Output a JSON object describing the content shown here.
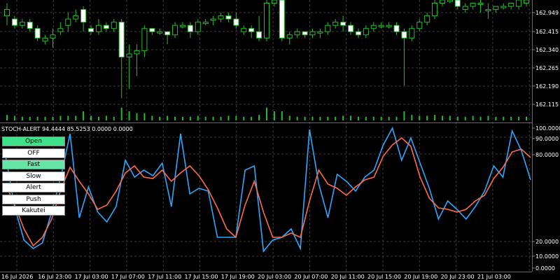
{
  "indicator_title": "STOCH-ALERT 94.4444 85.5253 0.0000 0.0000",
  "buttons": [
    {
      "label": "Open",
      "state": "on"
    },
    {
      "label": "OFF",
      "state": "off"
    },
    {
      "label": "Fast",
      "state": "on2"
    },
    {
      "label": "Slow",
      "state": "off"
    },
    {
      "label": "Alert",
      "state": "off"
    },
    {
      "label": "Push",
      "state": "off"
    },
    {
      "label": "Kakutei",
      "state": "off"
    }
  ],
  "colors": {
    "bull": "#ffffff",
    "bear": "#ffffff",
    "wick": "#1fbf2a",
    "volume": "#1fbf2a",
    "fast": "#2aa9ff",
    "slow": "#ff6a4d",
    "grid": "#3c3c3c"
  },
  "price_axis": [
    "162.949",
    "162.415",
    "162.340",
    "162.265",
    "162.190",
    "162.115"
  ],
  "stoch_axis": [
    "100.0000",
    "90.0000",
    "80.0000",
    "20.0000",
    "10.0000",
    "0.0000"
  ],
  "time_axis": [
    "16 Jul 2026",
    "16 Jul 23:00",
    "17 Jul 03:00",
    "17 Jul 07:00",
    "17 Jul 11:00",
    "17 Jul 15:00",
    "17 Jul 19:00",
    "20 Jul 03:00",
    "20 Jul 07:00",
    "20 Jul 11:00",
    "20 Jul 15:00",
    "20 Jul 19:00",
    "20 Jul 23:00",
    "21 Jul 03:00"
  ],
  "chart_data": {
    "type": "line",
    "title": "STOCH-ALERT",
    "price_ylim": [
      162.09,
      162.47
    ],
    "candles": [
      {
        "o": 162.42,
        "c": 162.44,
        "h": 162.46,
        "l": 162.39
      },
      {
        "o": 162.41,
        "c": 162.39,
        "h": 162.42,
        "l": 162.38
      },
      {
        "o": 162.39,
        "c": 162.4,
        "h": 162.41,
        "l": 162.38
      },
      {
        "o": 162.4,
        "c": 162.38,
        "h": 162.41,
        "l": 162.37
      },
      {
        "o": 162.38,
        "c": 162.35,
        "h": 162.39,
        "l": 162.34
      },
      {
        "o": 162.34,
        "c": 162.35,
        "h": 162.36,
        "l": 162.33
      },
      {
        "o": 162.35,
        "c": 162.36,
        "h": 162.38,
        "l": 162.32
      },
      {
        "o": 162.37,
        "c": 162.38,
        "h": 162.4,
        "l": 162.36
      },
      {
        "o": 162.39,
        "c": 162.41,
        "h": 162.43,
        "l": 162.37
      },
      {
        "o": 162.41,
        "c": 162.42,
        "h": 162.44,
        "l": 162.4
      },
      {
        "o": 162.44,
        "c": 162.4,
        "h": 162.45,
        "l": 162.37
      },
      {
        "o": 162.38,
        "c": 162.37,
        "h": 162.39,
        "l": 162.36
      },
      {
        "o": 162.37,
        "c": 162.39,
        "h": 162.41,
        "l": 162.36
      },
      {
        "o": 162.39,
        "c": 162.38,
        "h": 162.4,
        "l": 162.37
      },
      {
        "o": 162.38,
        "c": 162.4,
        "h": 162.41,
        "l": 162.37
      },
      {
        "o": 162.4,
        "c": 162.29,
        "h": 162.41,
        "l": 162.16
      },
      {
        "o": 162.29,
        "c": 162.3,
        "h": 162.33,
        "l": 162.19
      },
      {
        "o": 162.3,
        "c": 162.31,
        "h": 162.33,
        "l": 162.23
      },
      {
        "o": 162.31,
        "c": 162.38,
        "h": 162.39,
        "l": 162.29
      },
      {
        "o": 162.38,
        "c": 162.37,
        "h": 162.38,
        "l": 162.36
      },
      {
        "o": 162.37,
        "c": 162.37,
        "h": 162.38,
        "l": 162.36
      },
      {
        "o": 162.37,
        "c": 162.36,
        "h": 162.37,
        "l": 162.33
      },
      {
        "o": 162.36,
        "c": 162.39,
        "h": 162.4,
        "l": 162.35
      },
      {
        "o": 162.39,
        "c": 162.39,
        "h": 162.4,
        "l": 162.38
      },
      {
        "o": 162.39,
        "c": 162.37,
        "h": 162.4,
        "l": 162.35
      },
      {
        "o": 162.37,
        "c": 162.4,
        "h": 162.41,
        "l": 162.36
      },
      {
        "o": 162.4,
        "c": 162.4,
        "h": 162.41,
        "l": 162.39
      },
      {
        "o": 162.41,
        "c": 162.41,
        "h": 162.42,
        "l": 162.39
      },
      {
        "o": 162.41,
        "c": 162.42,
        "h": 162.43,
        "l": 162.4
      },
      {
        "o": 162.42,
        "c": 162.41,
        "h": 162.43,
        "l": 162.4
      },
      {
        "o": 162.41,
        "c": 162.39,
        "h": 162.43,
        "l": 162.38
      },
      {
        "o": 162.37,
        "c": 162.38,
        "h": 162.39,
        "l": 162.36
      },
      {
        "o": 162.38,
        "c": 162.37,
        "h": 162.39,
        "l": 162.35
      },
      {
        "o": 162.37,
        "c": 162.35,
        "h": 162.42,
        "l": 162.34
      },
      {
        "o": 162.35,
        "c": 162.46,
        "h": 162.48,
        "l": 162.34
      },
      {
        "o": 162.46,
        "c": 162.47,
        "h": 162.48,
        "l": 162.45
      },
      {
        "o": 162.47,
        "c": 162.35,
        "h": 162.48,
        "l": 162.34
      },
      {
        "o": 162.35,
        "c": 162.36,
        "h": 162.37,
        "l": 162.33
      },
      {
        "o": 162.36,
        "c": 162.37,
        "h": 162.38,
        "l": 162.35
      },
      {
        "o": 162.37,
        "c": 162.36,
        "h": 162.37,
        "l": 162.35
      },
      {
        "o": 162.36,
        "c": 162.37,
        "h": 162.38,
        "l": 162.35
      },
      {
        "o": 162.37,
        "c": 162.37,
        "h": 162.38,
        "l": 162.35
      },
      {
        "o": 162.37,
        "c": 162.39,
        "h": 162.4,
        "l": 162.36
      },
      {
        "o": 162.39,
        "c": 162.4,
        "h": 162.41,
        "l": 162.38
      },
      {
        "o": 162.4,
        "c": 162.39,
        "h": 162.42,
        "l": 162.37
      },
      {
        "o": 162.39,
        "c": 162.37,
        "h": 162.4,
        "l": 162.36
      },
      {
        "o": 162.37,
        "c": 162.36,
        "h": 162.38,
        "l": 162.35
      },
      {
        "o": 162.36,
        "c": 162.38,
        "h": 162.39,
        "l": 162.35
      },
      {
        "o": 162.38,
        "c": 162.39,
        "h": 162.4,
        "l": 162.37
      },
      {
        "o": 162.39,
        "c": 162.39,
        "h": 162.4,
        "l": 162.38
      },
      {
        "o": 162.39,
        "c": 162.39,
        "h": 162.4,
        "l": 162.38
      },
      {
        "o": 162.39,
        "c": 162.37,
        "h": 162.4,
        "l": 162.36
      },
      {
        "o": 162.37,
        "c": 162.35,
        "h": 162.38,
        "l": 162.2
      },
      {
        "o": 162.35,
        "c": 162.38,
        "h": 162.39,
        "l": 162.34
      },
      {
        "o": 162.38,
        "c": 162.4,
        "h": 162.41,
        "l": 162.37
      },
      {
        "o": 162.4,
        "c": 162.42,
        "h": 162.43,
        "l": 162.39
      },
      {
        "o": 162.42,
        "c": 162.46,
        "h": 162.47,
        "l": 162.41
      },
      {
        "o": 162.46,
        "c": 162.47,
        "h": 162.48,
        "l": 162.45
      },
      {
        "o": 162.47,
        "c": 162.47,
        "h": 162.48,
        "l": 162.46
      },
      {
        "o": 162.47,
        "c": 162.45,
        "h": 162.48,
        "l": 162.44
      },
      {
        "o": 162.44,
        "c": 162.45,
        "h": 162.46,
        "l": 162.43
      },
      {
        "o": 162.45,
        "c": 162.46,
        "h": 162.46,
        "l": 162.44
      },
      {
        "o": 162.46,
        "c": 162.46,
        "h": 162.47,
        "l": 162.43
      },
      {
        "o": 162.44,
        "c": 162.44,
        "h": 162.46,
        "l": 162.41
      },
      {
        "o": 162.44,
        "c": 162.45,
        "h": 162.45,
        "l": 162.43
      },
      {
        "o": 162.45,
        "c": 162.45,
        "h": 162.46,
        "l": 162.44
      },
      {
        "o": 162.45,
        "c": 162.46,
        "h": 162.46,
        "l": 162.44
      },
      {
        "o": 162.45,
        "c": 162.47,
        "h": 162.47,
        "l": 162.44
      },
      {
        "o": 162.46,
        "c": 162.47,
        "h": 162.47,
        "l": 162.45
      }
    ],
    "volume": [
      6,
      5,
      4,
      4,
      4,
      4,
      4,
      5,
      5,
      5,
      10,
      5,
      4,
      5,
      4,
      14,
      10,
      8,
      8,
      5,
      4,
      5,
      4,
      4,
      4,
      5,
      4,
      4,
      4,
      5,
      5,
      4,
      4,
      6,
      14,
      10,
      10,
      5,
      4,
      4,
      4,
      4,
      4,
      4,
      5,
      5,
      4,
      4,
      4,
      4,
      4,
      4,
      10,
      6,
      5,
      5,
      6,
      5,
      5,
      4,
      4,
      5,
      4,
      5,
      4,
      4,
      4,
      4,
      4
    ],
    "stoch_ylim": [
      0,
      100
    ],
    "series": [
      {
        "name": "fast",
        "values": [
          80,
          43,
          20,
          14,
          18,
          40,
          65,
          96,
          36,
          58,
          40,
          33,
          44,
          77,
          65,
          70,
          66,
          75,
          44,
          96,
          53,
          57,
          55,
          22,
          22,
          22,
          70,
          73,
          12,
          20,
          22,
          28,
          14,
          99,
          60,
          36,
          67,
          62,
          55,
          65,
          70,
          88,
          100,
          77,
          93,
          75,
          57,
          35,
          48,
          42,
          35,
          44,
          55,
          73,
          65,
          98,
          84,
          63
        ]
      },
      {
        "name": "slow",
        "values": [
          60,
          45,
          28,
          16,
          22,
          35,
          56,
          72,
          62,
          53,
          42,
          45,
          55,
          68,
          73,
          65,
          64,
          70,
          62,
          68,
          73,
          66,
          56,
          43,
          28,
          22,
          45,
          62,
          40,
          22,
          22,
          25,
          22,
          48,
          70,
          60,
          57,
          52,
          58,
          63,
          65,
          80,
          88,
          93,
          87,
          65,
          50,
          43,
          42,
          40,
          42,
          48,
          52,
          64,
          72,
          83,
          85,
          79
        ]
      }
    ]
  }
}
